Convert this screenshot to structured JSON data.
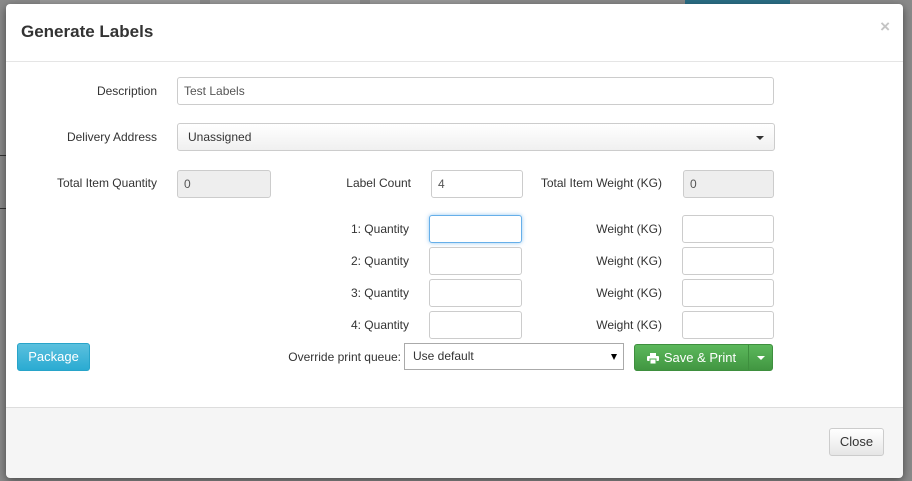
{
  "dialog": {
    "title": "Generate Labels",
    "close_glyph": "×"
  },
  "form": {
    "description_label": "Description",
    "description_value": "Test Labels",
    "delivery_label": "Delivery Address",
    "delivery_value": "Unassigned",
    "total_qty_label": "Total Item Quantity",
    "total_qty_value": "0",
    "label_count_label": "Label Count",
    "label_count_value": "4",
    "total_weight_label": "Total Item Weight (KG)",
    "total_weight_value": "0",
    "rows": [
      {
        "qty_label": "1: Quantity",
        "weight_label": "Weight (KG)"
      },
      {
        "qty_label": "2: Quantity",
        "weight_label": "Weight (KG)"
      },
      {
        "qty_label": "3: Quantity",
        "weight_label": "Weight (KG)"
      },
      {
        "qty_label": "4: Quantity",
        "weight_label": "Weight (KG)"
      }
    ]
  },
  "actions": {
    "package_label": "Package",
    "print_queue_label": "Override print queue:",
    "print_queue_value": "Use default",
    "save_print_label": "Save & Print",
    "close_label": "Close"
  },
  "icons": {
    "close": "close-icon",
    "caret": "chevron-down-icon",
    "printer": "printer-icon"
  },
  "colors": {
    "info": "#5bc0de",
    "success": "#5cb85c",
    "focus": "#66afe9"
  }
}
